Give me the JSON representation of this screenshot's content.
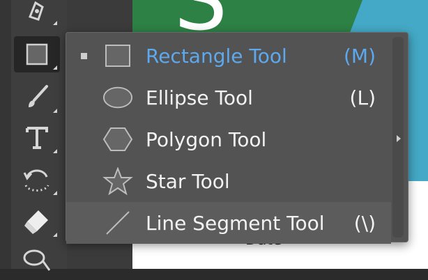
{
  "canvas": {
    "big_letter": "S",
    "bottom_text": "Date"
  },
  "toolbar": {
    "tools": [
      {
        "name": "pen-icon"
      },
      {
        "name": "rectangle-icon",
        "active": true
      },
      {
        "name": "paintbrush-icon"
      },
      {
        "name": "type-icon"
      },
      {
        "name": "rotate-icon"
      },
      {
        "name": "eraser-icon"
      },
      {
        "name": "lasso-icon"
      }
    ]
  },
  "flyout": {
    "items": [
      {
        "label": "Rectangle Tool",
        "shortcut": "(M)",
        "icon": "rectangle-icon",
        "selected": true
      },
      {
        "label": "Ellipse Tool",
        "shortcut": "(L)",
        "icon": "ellipse-icon"
      },
      {
        "label": "Polygon Tool",
        "shortcut": "",
        "icon": "polygon-icon"
      },
      {
        "label": "Star Tool",
        "shortcut": "",
        "icon": "star-icon"
      },
      {
        "label": "Line Segment Tool",
        "shortcut": "(\\)",
        "icon": "line-segment-icon",
        "hover": true
      }
    ]
  },
  "colors": {
    "selected_text": "#5ea8ee",
    "menu_bg": "#535353",
    "toolbar_bg": "#3e3e3e"
  }
}
